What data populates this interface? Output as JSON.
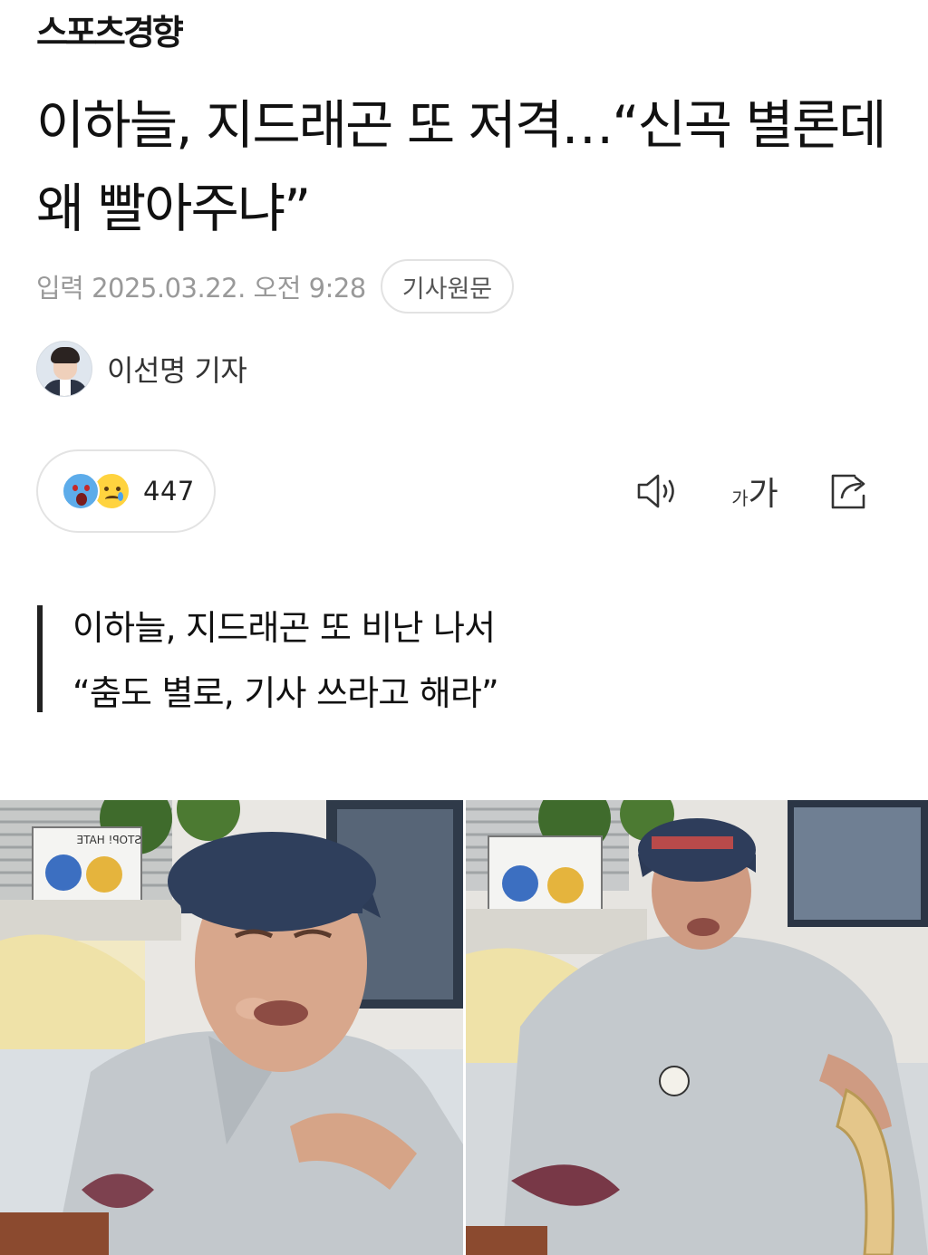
{
  "masthead": {
    "logo_text": "스포츠경향"
  },
  "article": {
    "headline": "이하늘, 지드래곤 또 저격…“신곡 별론데 왜 빨아주냐”",
    "date": "입력 2025.03.22. 오전 9:28",
    "original_button": "기사원문",
    "reporter_name": "이선명 기자",
    "reactions": {
      "count": "447",
      "icons": [
        "shocked-face-icon",
        "sad-face-icon"
      ]
    },
    "toolbar": {
      "font_small": "가",
      "font_big": "가",
      "icons": [
        "speaker-icon",
        "font-size-icon",
        "share-icon"
      ]
    },
    "subheading": {
      "line1": "이하늘, 지드래곤 또 비난 나서",
      "line2": "“춤도 별로, 기사 쓰라고 해라”"
    },
    "photo_sign_text": "STOP! HATE"
  },
  "colors": {
    "text": "#111111",
    "meta": "#999999",
    "border": "#e3e3e3",
    "accent_bar": "#222222"
  }
}
